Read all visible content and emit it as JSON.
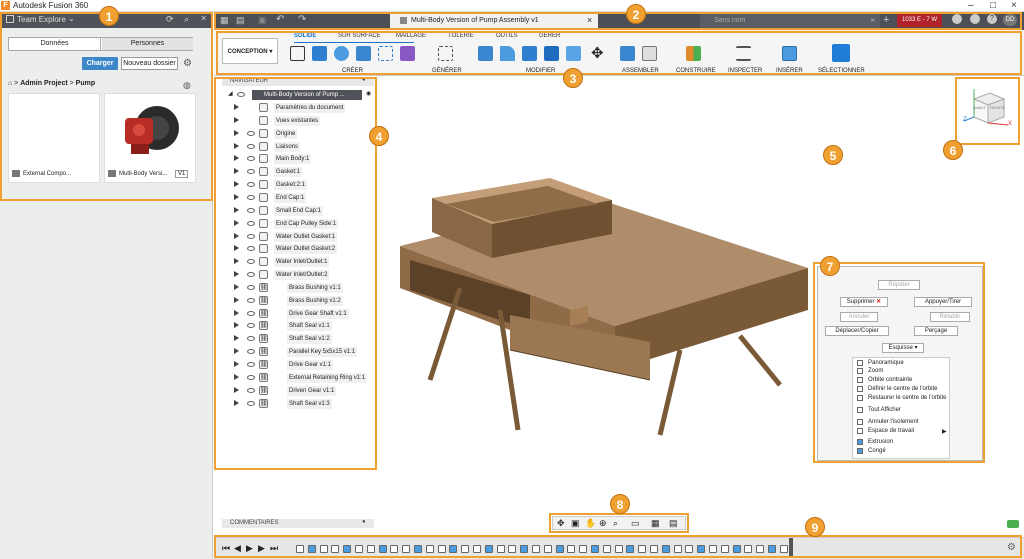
{
  "app": {
    "title": "Autodesk Fusion 360"
  },
  "data_panel": {
    "team": "Team Explore",
    "tabs": [
      "Données",
      "Personnes"
    ],
    "upload": "Charger",
    "new_folder": "Nouveau dossier",
    "breadcrumb": [
      "Admin Project",
      "Pump"
    ],
    "files": [
      {
        "name": "External Compo..."
      },
      {
        "name": "Multi-Body Versi...",
        "version": "V1"
      }
    ]
  },
  "doc": {
    "tab_title": "Multi-Body Version of Pump Assembly v1",
    "untitled": "Sans nom",
    "coords": "1033 E - 7 W",
    "user": "DD"
  },
  "ribbon": {
    "workspace": "CONCEPTION",
    "tabs": [
      "SOLIDE",
      "SUR SURFACE",
      "MAILLAGE",
      "TÔLERIE",
      "OUTILS",
      "GÉRER"
    ],
    "groups": [
      "CRÉER",
      "GÉNÉRER",
      "MODIFIER",
      "ASSEMBLER",
      "CONSTRUIRE",
      "INSPECTER",
      "INSÉRER",
      "SÉLECTIONNER"
    ]
  },
  "browser": {
    "title": "NAVIGATEUR",
    "root": "Multi-Body Version of Pump ...",
    "items": [
      "Paramètres du document",
      "Vues existantes",
      "Origine",
      "Liaisons",
      "Main Body:1",
      "Gasket:1",
      "Gasket:2:1",
      "End Cap:1",
      "Small End Cap:1",
      "End Cap Pulley Side:1",
      "Water Outlet Gasket:1",
      "Water Outlet Gasket:2",
      "Water Inlet/Outlet:1",
      "Water Inlet/Outlet:2",
      "Brass Bushing v1:1",
      "Brass Bushing v1:2",
      "Drive Gear Shaft v1:1",
      "Shaft Seal v1:1",
      "Shaft Seal v1:2",
      "Parallel Key 5x5x15 v1:1",
      "Drive Gear v1:1",
      "External Retaining Ring v1:1",
      "Driven Gear v1:1",
      "Shaft Seal v1:3"
    ],
    "comments": "COMMENTAIRES"
  },
  "viewcube": {
    "faces": [
      "AVANT",
      "DROITE"
    ],
    "axes": [
      "Z",
      "X"
    ]
  },
  "context_menu": {
    "repeat": "Répéter",
    "delete": "Supprimer",
    "press_pull": "Appuyer/Tirer",
    "undo": "Annuler",
    "redo": "Rétablir",
    "move_copy": "Déplacer/Copier",
    "hole": "Perçage",
    "sketch": "Esquisse",
    "items": [
      "Panoramique",
      "Zoom",
      "Orbite contrainte",
      "Définir le centre de l'orbite",
      "Restaurer le centre de l'orbite",
      "Tout Afficher",
      "Annuler l'isolement",
      "Espace de travail",
      "Extrusion",
      "Congé"
    ]
  },
  "callouts": [
    "1",
    "2",
    "3",
    "4",
    "5",
    "6",
    "7",
    "8",
    "9"
  ]
}
